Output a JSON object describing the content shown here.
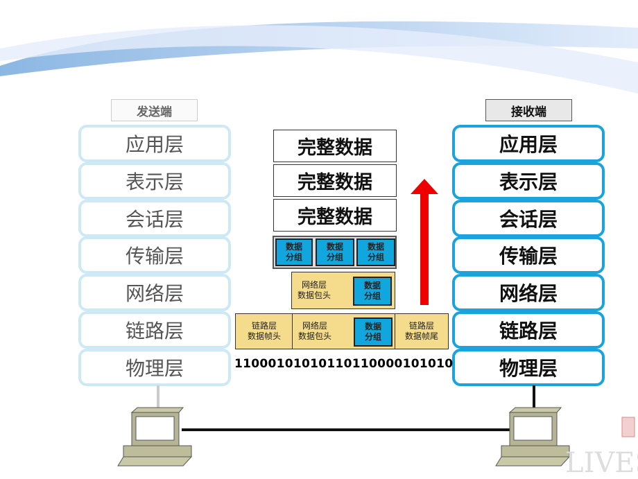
{
  "sender": {
    "label": "发送端",
    "layers": [
      "应用层",
      "表示层",
      "会话层",
      "传输层",
      "网络层",
      "链路层",
      "物理层"
    ]
  },
  "receiver": {
    "label": "接收端",
    "layers": [
      "应用层",
      "表示层",
      "会话层",
      "传输层",
      "网络层",
      "链路层",
      "物理层"
    ]
  },
  "data": {
    "full": "完整数据",
    "segment": "数据\n分组",
    "net_header": "网络层\n数据包头",
    "link_header": "链路层\n数据帧头",
    "link_trailer": "链路层\n数据帧尾",
    "bits": "11000101010110110000101010"
  },
  "watermark": "LIVES",
  "colors": {
    "accent": "#1aa3dc",
    "arrow": "#ee0000",
    "frame": "#f5dc8c"
  }
}
